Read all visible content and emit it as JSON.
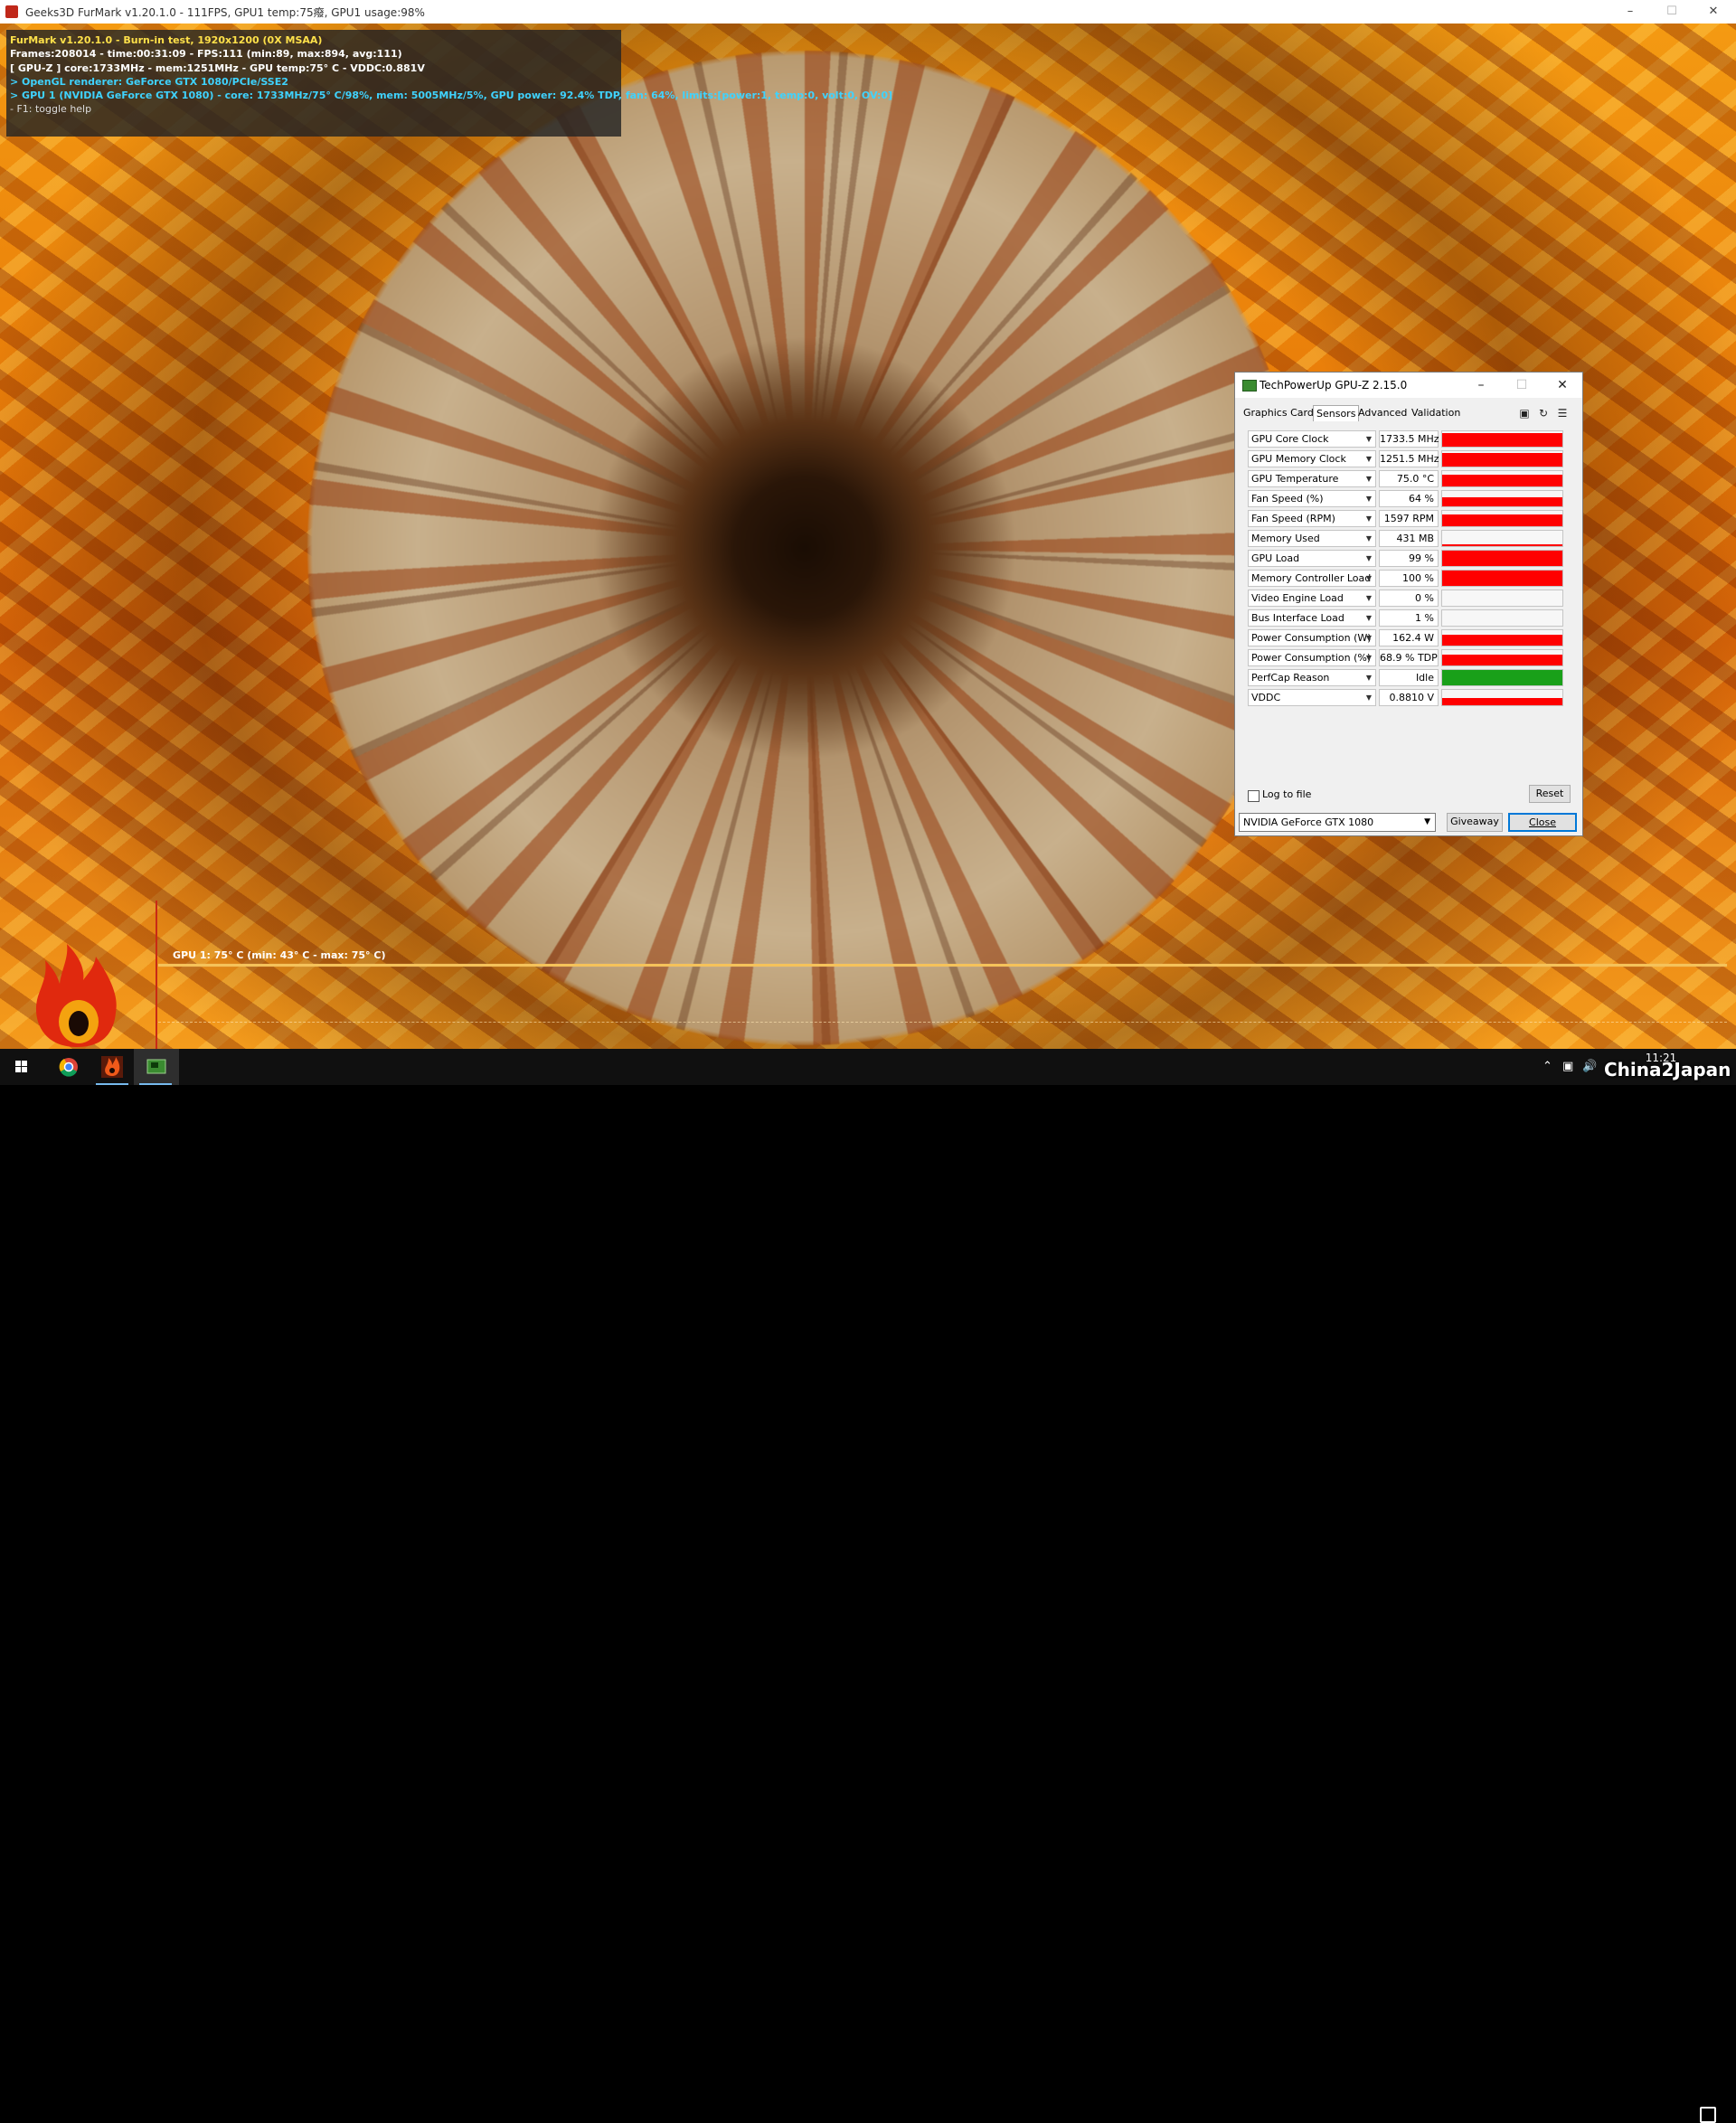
{
  "furmark": {
    "window_title": "Geeks3D FurMark v1.20.1.0 - 111FPS, GPU1 temp:75癈, GPU1 usage:98%",
    "hud": {
      "line1": "FurMark v1.20.1.0 - Burn-in test, 1920x1200 (0X MSAA)",
      "line2": "Frames:208014 - time:00:31:09 - FPS:111 (min:89, max:894, avg:111)",
      "line3": "[ GPU-Z ] core:1733MHz - mem:1251MHz - GPU temp:75° C - VDDC:0.881V",
      "line4": "> OpenGL renderer: GeForce GTX 1080/PCIe/SSE2",
      "line5": "> GPU 1 (NVIDIA GeForce GTX 1080) - core: 1733MHz/75° C/98%, mem: 5005MHz/5%, GPU power: 92.4% TDP, fan: 64%, limits:[power:1, temp:0, volt:0, OV:0]",
      "line6": "- F1: toggle help"
    },
    "temp_graph_label": "GPU 1: 75° C (min: 43° C - max: 75° C)"
  },
  "gpuz": {
    "title": "TechPowerUp GPU-Z 2.15.0",
    "tabs": [
      "Graphics Card",
      "Sensors",
      "Advanced",
      "Validation"
    ],
    "active_tab": "Sensors",
    "sensors": [
      {
        "name": "GPU Core Clock",
        "value": "1733.5 MHz",
        "level": 0.9,
        "color": "#ff0000"
      },
      {
        "name": "GPU Memory Clock",
        "value": "1251.5 MHz",
        "level": 0.9,
        "color": "#ff0000"
      },
      {
        "name": "GPU Temperature",
        "value": "75.0 °C",
        "level": 0.75,
        "color": "#ff0000"
      },
      {
        "name": "Fan Speed (%)",
        "value": "64 %",
        "level": 0.6,
        "color": "#ff0000"
      },
      {
        "name": "Fan Speed (RPM)",
        "value": "1597 RPM",
        "level": 0.75,
        "color": "#ff0000"
      },
      {
        "name": "Memory Used",
        "value": "431 MB",
        "level": 0.1,
        "color": "#ff0000"
      },
      {
        "name": "GPU Load",
        "value": "99 %",
        "level": 0.99,
        "color": "#ff0000"
      },
      {
        "name": "Memory Controller Load",
        "value": "100 %",
        "level": 1.0,
        "color": "#ff0000"
      },
      {
        "name": "Video Engine Load",
        "value": "0 %",
        "level": 0.0,
        "color": "#ff0000"
      },
      {
        "name": "Bus Interface Load",
        "value": "1 %",
        "level": 0.02,
        "color": "#ff0000"
      },
      {
        "name": "Power Consumption (W)",
        "value": "162.4 W",
        "level": 0.7,
        "color": "#ff0000"
      },
      {
        "name": "Power Consumption (%)",
        "value": "68.9 % TDP",
        "level": 0.7,
        "color": "#ff0000"
      },
      {
        "name": "PerfCap Reason",
        "value": "Idle",
        "level": 1.0,
        "color": "#19a019"
      },
      {
        "name": "VDDC",
        "value": "0.8810 V",
        "level": 0.45,
        "color": "#ff0000"
      }
    ],
    "log_to_file": "Log to file",
    "reset": "Reset",
    "gpu_select": "NVIDIA GeForce GTX 1080",
    "giveaway": "Giveaway",
    "close": "Close"
  },
  "taskbar": {
    "clock_time": "11:21",
    "watermark": "China2Japan"
  }
}
